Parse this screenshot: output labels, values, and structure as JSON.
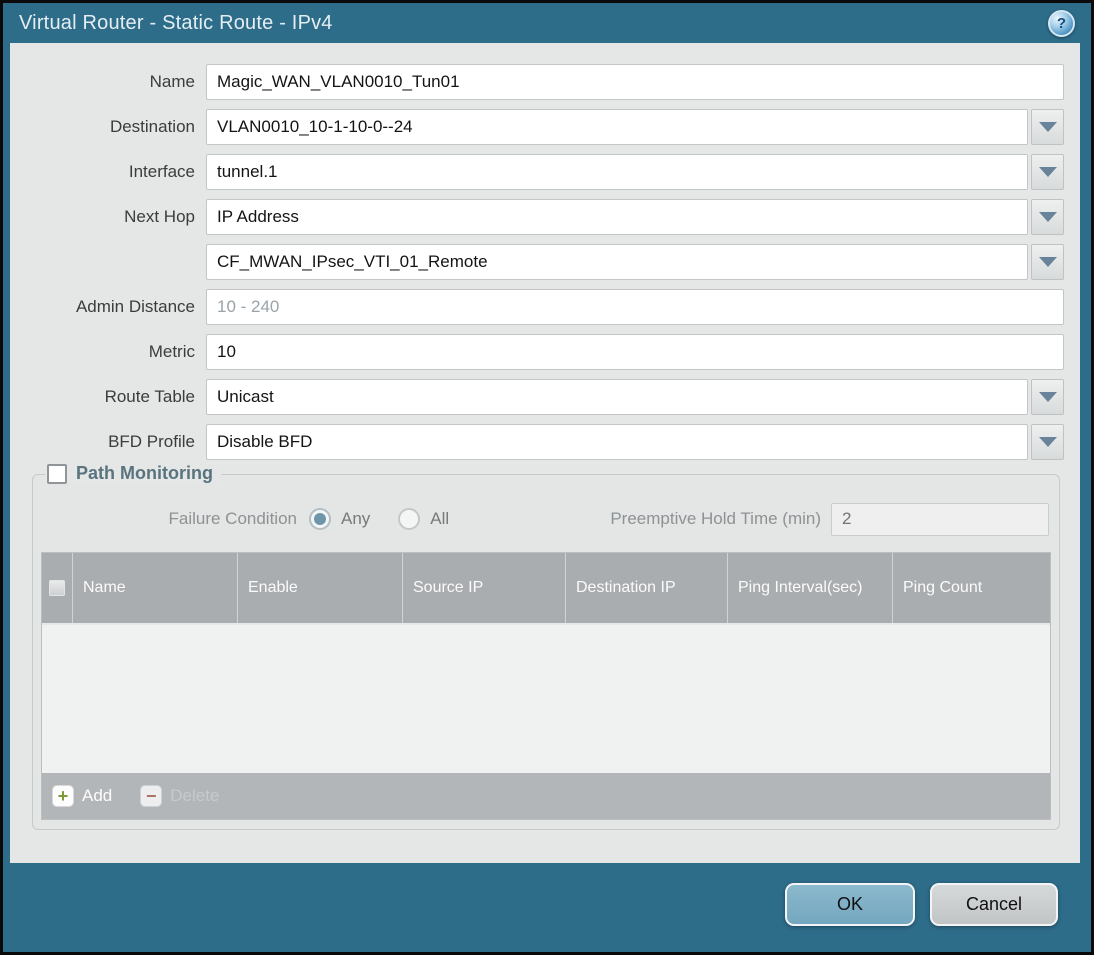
{
  "title": "Virtual Router - Static Route - IPv4",
  "help_icon": "?",
  "colors": {
    "titlebar": "#2e6d8a",
    "content_bg": "#e5e6e6",
    "table_header_bg": "#aaadb0",
    "ok_button": "#7fb0c6",
    "cancel_button": "#c9cccd",
    "add_icon_green": "#7c9c35",
    "delete_icon_red": "#a8625a",
    "pm_title": "#59747f"
  },
  "form": {
    "fields": [
      {
        "label": "Name",
        "value": "Magic_WAN_VLAN0010_Tun01",
        "type": "text"
      },
      {
        "label": "Destination",
        "value": "VLAN0010_10-1-10-0--24",
        "type": "dropdown"
      },
      {
        "label": "Interface",
        "value": "tunnel.1",
        "type": "dropdown"
      },
      {
        "label": "Next Hop",
        "value": "IP Address",
        "type": "dropdown"
      },
      {
        "label": "",
        "value": "CF_MWAN_IPsec_VTI_01_Remote",
        "type": "dropdown"
      },
      {
        "label": "Admin Distance",
        "value": "",
        "placeholder": "10 - 240",
        "type": "text"
      },
      {
        "label": "Metric",
        "value": "10",
        "type": "text"
      },
      {
        "label": "Route Table",
        "value": "Unicast",
        "type": "dropdown"
      },
      {
        "label": "BFD Profile",
        "value": "Disable BFD",
        "type": "dropdown"
      }
    ]
  },
  "path_monitoring": {
    "title": "Path Monitoring",
    "checkbox_checked": false,
    "failure_condition_label": "Failure Condition",
    "options": [
      {
        "label": "Any",
        "selected": true
      },
      {
        "label": "All",
        "selected": false
      }
    ],
    "preemptive_label": "Preemptive Hold Time (min)",
    "preemptive_value": "2",
    "table": {
      "columns": [
        "Name",
        "Enable",
        "Source IP",
        "Destination IP",
        "Ping Interval(sec)",
        "Ping Count"
      ],
      "rows": []
    },
    "add_label": "Add",
    "delete_label": "Delete"
  },
  "footer": {
    "ok_label": "OK",
    "cancel_label": "Cancel"
  }
}
